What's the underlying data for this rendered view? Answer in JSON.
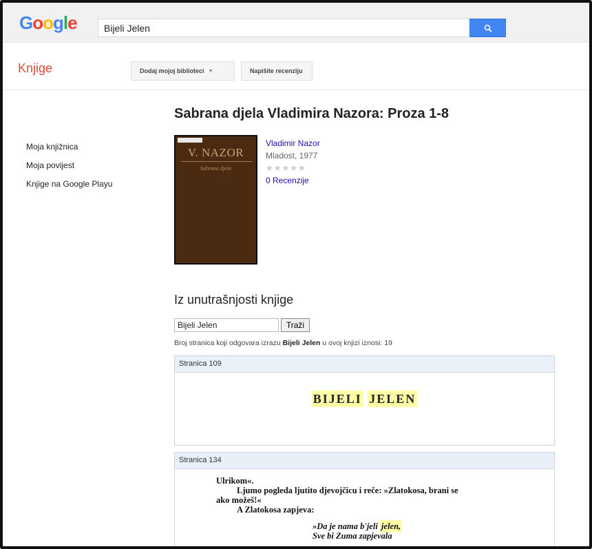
{
  "header": {
    "logo": "Google",
    "search_value": "Bijeli Jelen",
    "search_icon": "search-icon"
  },
  "subbar": {
    "section": "Knjige",
    "add_library_label": "Dodaj mojoj biblioteci",
    "review_label": "Napišite recenziju"
  },
  "leftnav": {
    "items": [
      {
        "label": "Moja knjižnica"
      },
      {
        "label": "Moja povijest"
      },
      {
        "label": "Knjige na Google Playu"
      }
    ]
  },
  "book": {
    "title": "Sabrana djela Vladimira Nazora: Proza 1-8",
    "author": "Vladimir Nazor",
    "publisher": "Mladost, 1977",
    "rating_stars": "★★★★★",
    "rating_value": 0,
    "reviews": "0 Recenzije",
    "cover": {
      "author": "V. NAZOR",
      "subtitle": "Sabrana djela"
    }
  },
  "inside": {
    "title": "Iz unutrašnjosti knjige",
    "query": "Bijeli Jelen",
    "button": "Traži",
    "match_prefix": "Broj stranica koji odgovara izrazu",
    "match_term": "Bijeli Jelen",
    "match_suffix": "u ovoj knjizi iznosi: 19"
  },
  "results": [
    {
      "page": "Stranica 109",
      "word1": "BIJELI",
      "word2": "JELEN"
    },
    {
      "page": "Stranica 134",
      "lines": [
        "Ulrikom«.",
        "Ljumo pogleda ljutito djevojčicu i reče: »Zlatokosa, brani se",
        "ako možeš!«",
        "A Zlatokosa zapjeva:",
        "»Da je nama b'jeli",
        "jelen,",
        "Sve bi Zuma zapjevala"
      ]
    }
  ]
}
